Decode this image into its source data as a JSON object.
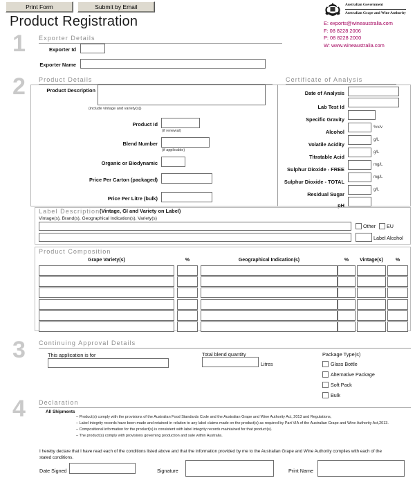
{
  "toolbar": {
    "print_label": "Print Form",
    "email_label": "Submit by Email"
  },
  "header": {
    "title": "Product Registration",
    "crest_line1": "Australian Government",
    "crest_line2": "Australian Grape and Wine Authority",
    "contact": {
      "email": "E: exports@wineaustralia.com",
      "fax": "F: 08 8228 2006",
      "phone": "P: 08 8228 2000",
      "web": "W: www.wineaustralia.com"
    }
  },
  "section1": {
    "number": "1",
    "heading": "Exporter Details",
    "exporter_id_label": "Exporter Id",
    "exporter_id_value": "",
    "exporter_name_label": "Exporter Name",
    "exporter_name_value": ""
  },
  "section2": {
    "number": "2",
    "heading": "Product Details",
    "fields": [
      {
        "label": "Product Description",
        "hint": "(include vintage and variety(s))",
        "value": ""
      },
      {
        "label": "Product Id",
        "hint": "(if renewal)",
        "value": ""
      },
      {
        "label": "Blend Number",
        "hint": "(if applicable)",
        "value": ""
      },
      {
        "label": "Organic or Biodynamic",
        "hint": "",
        "value": ""
      },
      {
        "label": "Price Per Carton (packaged)",
        "hint": "",
        "value": ""
      },
      {
        "label": "Price Per Litre (bulk)",
        "hint": "",
        "value": ""
      }
    ],
    "coa_heading": "Certificate of Analysis",
    "coa_fields": [
      {
        "label": "Date of Analysis",
        "unit": "",
        "value": ""
      },
      {
        "label": "Lab Test Id",
        "unit": "",
        "value": ""
      },
      {
        "label": "Specific Gravity",
        "unit": "",
        "value": ""
      },
      {
        "label": "Alcohol",
        "unit": "%v/v",
        "value": ""
      },
      {
        "label": "Volatile Acidity",
        "unit": "g/L",
        "value": ""
      },
      {
        "label": "Titratable Acid",
        "unit": "g/L",
        "value": ""
      },
      {
        "label": "Sulphur Dioxide - FREE",
        "unit": "mg/L",
        "value": ""
      },
      {
        "label": "Sulphur Dioxide - TOTAL",
        "unit": "mg/L",
        "value": ""
      },
      {
        "label": "Residual Sugar",
        "unit": "g/L",
        "value": ""
      },
      {
        "label": "pH",
        "unit": "",
        "value": ""
      }
    ]
  },
  "label_description": {
    "heading": "Label Description",
    "heading_note": "(Vintage, GI and Variety on Label)",
    "subtitle": "Vintage(s), Brand(s), Geographical Indication(s), Variety(s)",
    "line1_value": "",
    "line2_value": "",
    "other_label": "Other",
    "eu_label": "EU",
    "label_alcohol_label": "Label Alcohol",
    "label_alcohol_value": ""
  },
  "product_composition": {
    "heading": "Product Composition",
    "columns": [
      "Grape Variety(s)",
      "%",
      "Geographical Indication(s)",
      "%",
      "Vintage(s)",
      "%"
    ],
    "rows": [
      [
        "",
        "",
        "",
        "",
        "",
        ""
      ],
      [
        "",
        "",
        "",
        "",
        "",
        ""
      ],
      [
        "",
        "",
        "",
        "",
        "",
        ""
      ],
      [
        "",
        "",
        "",
        "",
        "",
        ""
      ],
      [
        "",
        "",
        "",
        "",
        "",
        ""
      ],
      [
        "",
        "",
        "",
        "",
        "",
        ""
      ]
    ]
  },
  "section3": {
    "number": "3",
    "heading": "Continuing Approval Details",
    "application_label": "This application is for",
    "application_value": "",
    "blend_label": "Total blend quantity",
    "blend_value": "",
    "blend_unit": "Litres",
    "package_label": "Package Type(s)",
    "package_options": [
      "Glass Bottle",
      "Alternative Package",
      "Soft Pack",
      "Bulk"
    ]
  },
  "section4": {
    "number": "4",
    "heading": "Declaration",
    "all_shipments": "All Shipments",
    "bullets": [
      "– Product(s) comply with the provisions of the Australian Food Standards Code and the Australian Grape and Wine Authority Act, 2013 and Regulations,",
      "– Label integrity records have been made and retained in relation to any label claims made on the product(s) as required by Part VIA of the Australian Grape and Wine Authority Act,2013.",
      "– Compositional information for the product(s) is consistent with label integrity records maintained for that product(s).",
      "– The product(s) comply with provisions governing production and sale within Australia."
    ],
    "statement": "I hereby declare that I have read each of the conditions listed above and that the information provided by me to the Australian Grape and Wine Authority complies with each of the stated conditions.",
    "date_label": "Date Signed",
    "date_value": "",
    "signature_label": "Signature",
    "signature_value": "",
    "printname_label": "Print Name",
    "printname_value": ""
  }
}
